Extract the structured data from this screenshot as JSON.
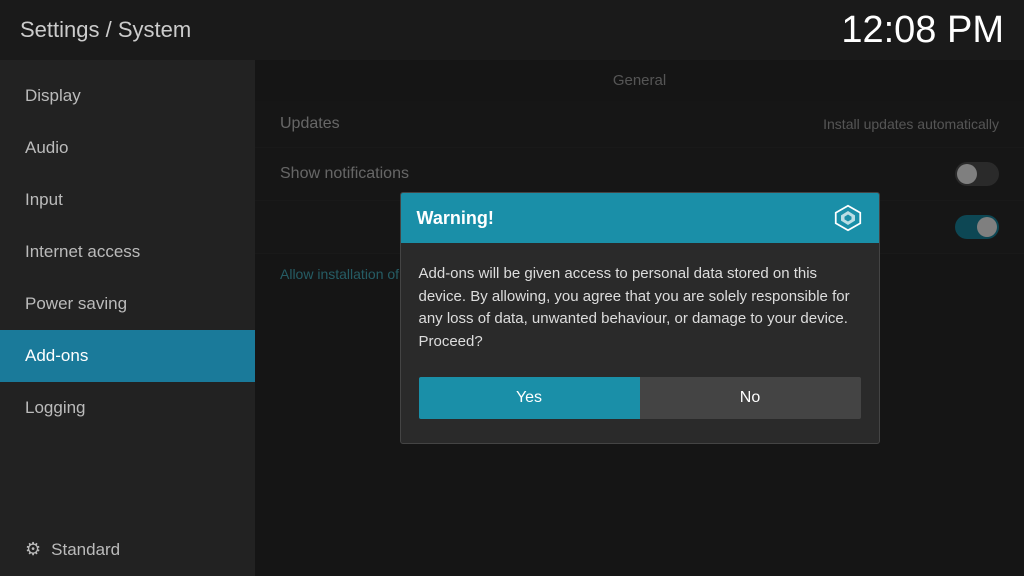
{
  "header": {
    "title": "Settings / System",
    "time": "12:08 PM"
  },
  "sidebar": {
    "items": [
      {
        "id": "display",
        "label": "Display",
        "active": false
      },
      {
        "id": "audio",
        "label": "Audio",
        "active": false
      },
      {
        "id": "input",
        "label": "Input",
        "active": false
      },
      {
        "id": "internet-access",
        "label": "Internet access",
        "active": false
      },
      {
        "id": "power-saving",
        "label": "Power saving",
        "active": false
      },
      {
        "id": "add-ons",
        "label": "Add-ons",
        "active": true
      },
      {
        "id": "logging",
        "label": "Logging",
        "active": false
      }
    ],
    "footer": {
      "label": "Standard"
    }
  },
  "main": {
    "section_label": "General",
    "rows": [
      {
        "id": "updates",
        "label": "Updates",
        "value": "Install updates automatically",
        "has_toggle": false
      },
      {
        "id": "show-notifications",
        "label": "Show notifications",
        "value": "",
        "has_toggle": true,
        "toggle_on": false
      }
    ],
    "toggle2_on": true,
    "link_text": "Allow installation of add-ons from unknown sources"
  },
  "dialog": {
    "title": "Warning!",
    "body": "Add-ons will be given access to personal data stored on this device. By allowing, you agree that you are solely responsible for any loss of data, unwanted behaviour, or damage to your device. Proceed?",
    "btn_yes": "Yes",
    "btn_no": "No"
  }
}
